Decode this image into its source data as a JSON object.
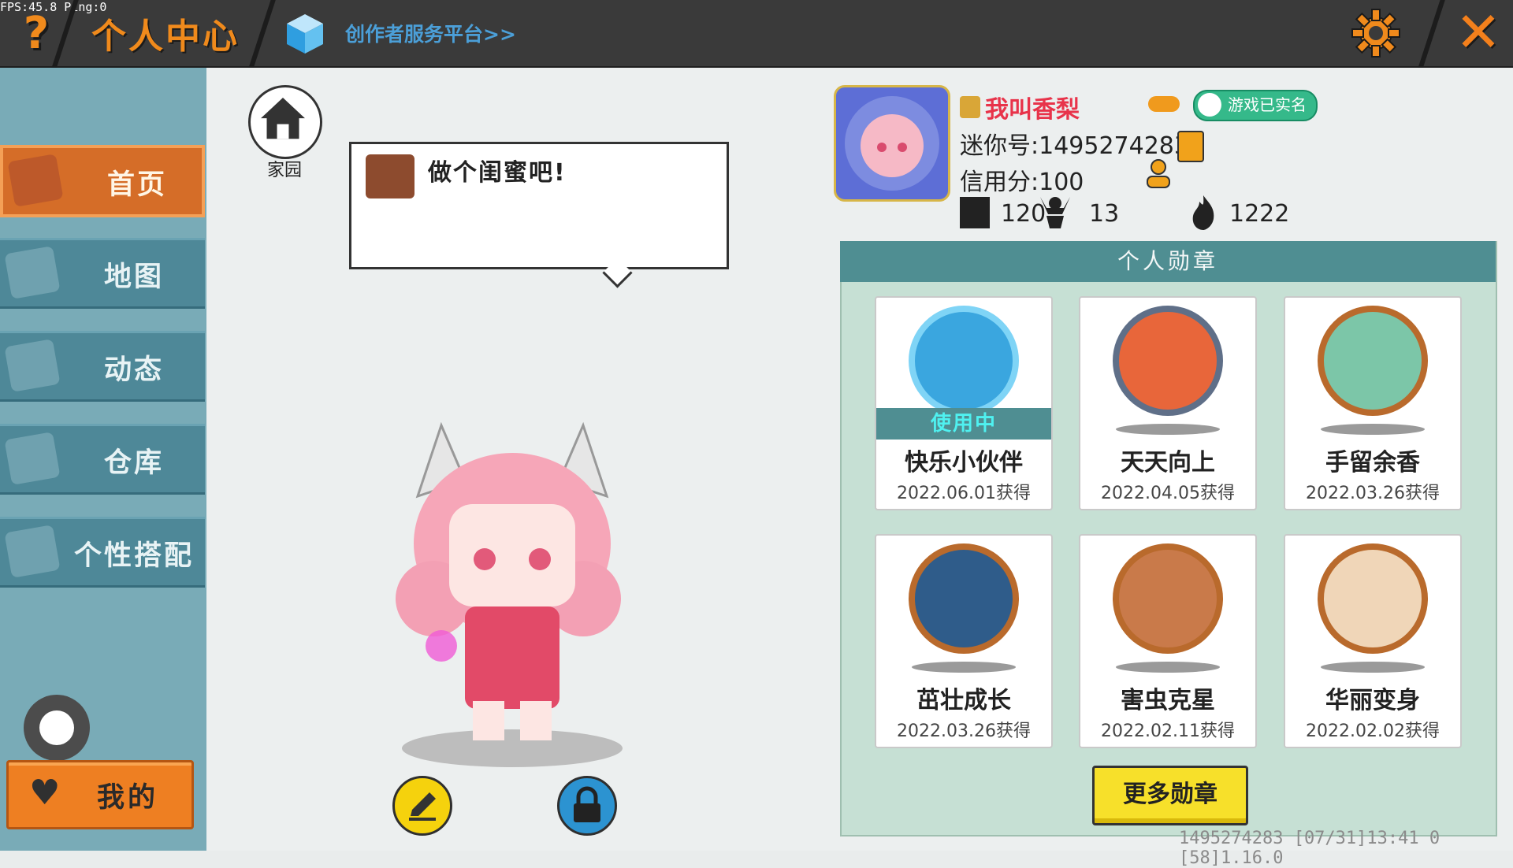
{
  "debug": {
    "fps_text": "FPS:45.8  Ping:0"
  },
  "header": {
    "help_label": "?",
    "title": "个人中心",
    "creator_link": "创作者服务平台>>",
    "close_label": "✕"
  },
  "sidebar": {
    "items": [
      {
        "label": "首页",
        "icon": "house-icon",
        "active": true
      },
      {
        "label": "地图",
        "icon": "map-icon",
        "active": false
      },
      {
        "label": "动态",
        "icon": "bell-icon",
        "active": false
      },
      {
        "label": "仓库",
        "icon": "warehouse-icon",
        "active": false
      },
      {
        "label": "个性搭配",
        "icon": "outfit-icon",
        "active": false
      }
    ],
    "mine_label": "我的"
  },
  "stage": {
    "home_label": "家园",
    "speech": "做个闺蜜吧!"
  },
  "profile": {
    "nickname": "我叫香梨",
    "realname_badge": "游戏已实名",
    "uid_text": "迷你号:1495274283",
    "credit_text": "信用分:100",
    "stats": {
      "plus": "120",
      "fans": "13",
      "heat": "1222"
    }
  },
  "badges": {
    "header": "个人勋章",
    "in_use_label": "使用中",
    "items": [
      {
        "name": "快乐小伙伴",
        "date": "2022.06.01获得",
        "in_use": true,
        "color": "#3aa6df"
      },
      {
        "name": "天天向上",
        "date": "2022.04.05获得",
        "in_use": false,
        "color": "#e8663a"
      },
      {
        "name": "手留余香",
        "date": "2022.03.26获得",
        "in_use": false,
        "color": "#7cc6a8"
      },
      {
        "name": "茁壮成长",
        "date": "2022.03.26获得",
        "in_use": false,
        "color": "#2f5c8a"
      },
      {
        "name": "害虫克星",
        "date": "2022.02.11获得",
        "in_use": false,
        "color": "#c97a4a"
      },
      {
        "name": "华丽变身",
        "date": "2022.02.02获得",
        "in_use": false,
        "color": "#f0d6b8"
      }
    ],
    "more_label": "更多勋章"
  },
  "footer": {
    "text": "1495274283   [07/31]13:41 0  [58]1.16.0"
  },
  "colors": {
    "accent": "#f08a1c",
    "nav_bg": "#4e8898",
    "nav_active": "#d56d28",
    "panel": "#c6e0d4",
    "header_teal": "#4f8e92"
  }
}
